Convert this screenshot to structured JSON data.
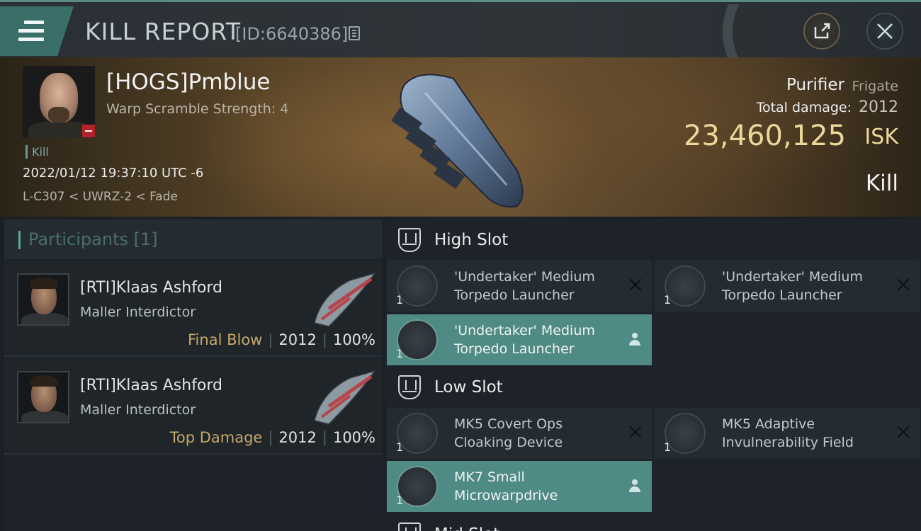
{
  "header": {
    "title": "KILL REPORT",
    "report_id": "[ID:6640386]"
  },
  "victim": {
    "name": "[HOGS]Pmblue",
    "warp_scramble": "Warp Scramble Strength: 4",
    "tag": "Kill",
    "datetime": "2022/01/12 19:37:10 UTC -6",
    "location": "L-C307 < UWRZ-2 < Fade",
    "ship_name": "Purifier",
    "ship_class": "Frigate",
    "total_damage_label": "Total damage:",
    "total_damage": "2012",
    "isk_value": "23,460,125",
    "isk_label": "ISK",
    "type": "Kill"
  },
  "participants": {
    "title": "Participants",
    "count": "[1]",
    "rows": [
      {
        "name": "[RTI]Klaas Ashford",
        "ship": "Maller Interdictor",
        "tag": "Final Blow",
        "damage": "2012",
        "percent": "100%"
      },
      {
        "name": "[RTI]Klaas Ashford",
        "ship": "Maller Interdictor",
        "tag": "Top Damage",
        "damage": "2012",
        "percent": "100%"
      }
    ]
  },
  "fitting": {
    "high_slot": {
      "title": "High Slot",
      "modules": [
        {
          "name": "'Undertaker' Medium Torpedo Launcher",
          "qty": "1",
          "status": "destroyed",
          "icon": "torpedo-launcher-icon"
        },
        {
          "name": "'Undertaker' Medium Torpedo Launcher",
          "qty": "1",
          "status": "destroyed",
          "icon": "torpedo-launcher-icon"
        },
        {
          "name": "'Undertaker' Medium Torpedo Launcher",
          "qty": "1",
          "status": "dropped",
          "icon": "torpedo-launcher-icon"
        }
      ]
    },
    "low_slot": {
      "title": "Low Slot",
      "modules": [
        {
          "name": "MK5 Covert Ops Cloaking Device",
          "qty": "1",
          "status": "destroyed",
          "icon": "cloaking-device-icon"
        },
        {
          "name": "MK5 Adaptive Invulnerability Field",
          "qty": "1",
          "status": "destroyed",
          "icon": "invulnerability-field-icon"
        },
        {
          "name": "MK7 Small Microwarpdrive",
          "qty": "1",
          "status": "dropped",
          "icon": "microwarpdrive-icon"
        }
      ]
    },
    "mid_slot": {
      "title": "Mid Slot"
    }
  },
  "colors": {
    "accent": "#4f8a84",
    "isk_gold": "#ecd89a",
    "final_blow": "#c7a86a",
    "security_badge": "#b3242a"
  }
}
